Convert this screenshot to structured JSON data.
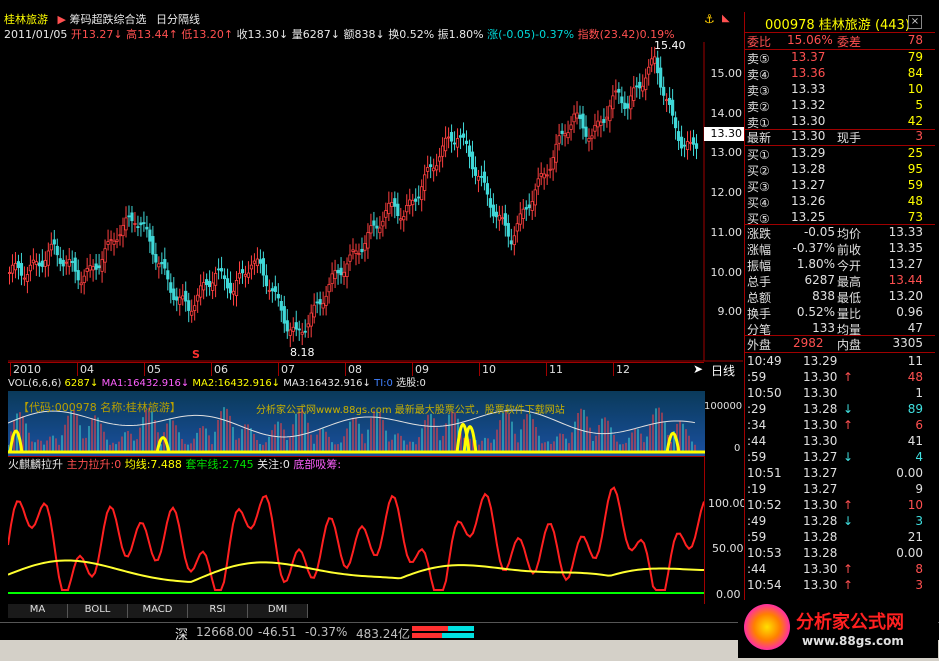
{
  "header": {
    "stock": "桂林旅游",
    "arrow": "▶",
    "formula": "筹码超跌综合选",
    "period": "日分隔线"
  },
  "info": {
    "date": "2011/01/05",
    "open": "开13.27↓",
    "high": "高13.44↑",
    "low": "低13.20↑",
    "close": "收13.30↓",
    "vol": "量6287↓",
    "amount": "额838↓",
    "turnover": "换0.52%",
    "amplitude": "振1.80%",
    "change": "涨(-0.05)-0.37%",
    "index": "指数(23.42)0.19%"
  },
  "price_axis": [
    "15.00",
    "14.00",
    "13.00",
    "12.00",
    "11.00",
    "10.00",
    "9.00"
  ],
  "price_marker": "13.30",
  "price_max_label": "15.40",
  "price_min_label": "8.18",
  "s_marker": "S",
  "months": [
    "2010",
    "04",
    "05",
    "06",
    "07",
    "08",
    "09",
    "10",
    "11",
    "12"
  ],
  "period_label": "日线",
  "vol_line": {
    "vol": "VOL(6,6,6)",
    "val": "6287↓",
    "ma1": "MA1:16432.916↓",
    "ma2": "MA2:16432.916↓",
    "ma3": "MA3:16432.916↓",
    "ti": "TI:0",
    "xg": "选股:0"
  },
  "vol_axis": [
    "100000",
    "0"
  ],
  "watermark1": "【代码:000978 名称:桂林旅游】",
  "watermark2": "分析家公式网www.88gs.com 最新最大股票公式，股票软件下载网站",
  "ind_line": {
    "name": "火麒麟拉升",
    "main": "主力拉升:0",
    "avg": "均线:7.488",
    "tao": "套牢线:2.745",
    "gz": "关注:0",
    "bottom": "底部吸筹:"
  },
  "ind_axis": [
    "100.00",
    "50.00",
    "0.00"
  ],
  "tabs": [
    "MA",
    "BOLL",
    "MACD",
    "RSI",
    "DMI"
  ],
  "status": {
    "mkt": "深",
    "idx": "12668.00",
    "chg": "-46.51",
    "pct": "-0.37%",
    "amt": "483.24亿"
  },
  "quote": {
    "code": "000978",
    "name": "桂林旅游",
    "count": "(443)",
    "weibi_l": "委比",
    "weibi": "15.06%",
    "weicha_l": "委差",
    "weicha": "78",
    "asks": [
      {
        "l": "卖⑤",
        "p": "13.37",
        "v": "79"
      },
      {
        "l": "卖④",
        "p": "13.36",
        "v": "84"
      },
      {
        "l": "卖③",
        "p": "13.33",
        "v": "10"
      },
      {
        "l": "卖②",
        "p": "13.32",
        "v": "5"
      },
      {
        "l": "卖①",
        "p": "13.30",
        "v": "42"
      }
    ],
    "last_l": "最新",
    "last": "13.30",
    "now_l": "现手",
    "now": "3",
    "bids": [
      {
        "l": "买①",
        "p": "13.29",
        "v": "25"
      },
      {
        "l": "买②",
        "p": "13.28",
        "v": "95"
      },
      {
        "l": "买③",
        "p": "13.27",
        "v": "59"
      },
      {
        "l": "买④",
        "p": "13.26",
        "v": "48"
      },
      {
        "l": "买⑤",
        "p": "13.25",
        "v": "73"
      }
    ],
    "stats": [
      [
        "涨跌",
        "-0.05",
        "均价",
        "13.33"
      ],
      [
        "涨幅",
        "-0.37%",
        "前收",
        "13.35"
      ],
      [
        "振幅",
        "1.80%",
        "今开",
        "13.27"
      ],
      [
        "总手",
        "6287",
        "最高",
        "13.44"
      ],
      [
        "总额",
        "838",
        "最低",
        "13.20"
      ],
      [
        "换手",
        "0.52%",
        "量比",
        "0.96"
      ],
      [
        "分笔",
        "133",
        "均量",
        "47"
      ]
    ],
    "wai_l": "外盘",
    "wai": "2982",
    "nei_l": "内盘",
    "nei": "3305"
  },
  "ticks": [
    [
      "10:49",
      "13.29",
      "",
      "11"
    ],
    [
      ":59",
      "13.30",
      "↑",
      "48"
    ],
    [
      "10:50",
      "13.30",
      "",
      "1"
    ],
    [
      ":29",
      "13.28",
      "↓",
      "89"
    ],
    [
      ":34",
      "13.30",
      "↑",
      "6"
    ],
    [
      ":44",
      "13.30",
      "",
      "41"
    ],
    [
      ":59",
      "13.27",
      "↓",
      "4"
    ],
    [
      "10:51",
      "13.27",
      "",
      "0.00"
    ],
    [
      ":19",
      "13.27",
      "",
      "9"
    ],
    [
      "10:52",
      "13.30",
      "↑",
      "10"
    ],
    [
      ":49",
      "13.28",
      "↓",
      "3"
    ],
    [
      ":59",
      "13.28",
      "",
      "21"
    ],
    [
      "10:53",
      "13.28",
      "",
      "0.00"
    ],
    [
      ":44",
      "13.30",
      "↑",
      "8"
    ],
    [
      "10:54",
      "13.30",
      "↑",
      "3"
    ]
  ],
  "logo": "分析家公式网",
  "logo_url": "www.88gs.com",
  "chart_data": {
    "type": "candlestick",
    "ylim": [
      7.8,
      15.8
    ],
    "months": [
      "2010",
      "04",
      "05",
      "06",
      "07",
      "08",
      "09",
      "10",
      "11",
      "12"
    ],
    "closes": [
      10.0,
      10.1,
      10.0,
      10.2,
      10.4,
      10.6,
      10.3,
      10.1,
      9.9,
      10.0,
      10.3,
      10.6,
      11.0,
      11.2,
      11.4,
      11.1,
      10.6,
      10.1,
      9.6,
      9.3,
      9.1,
      9.4,
      9.7,
      10.0,
      9.8,
      9.6,
      9.9,
      10.3,
      10.1,
      9.7,
      9.2,
      8.7,
      8.4,
      8.7,
      9.0,
      9.4,
      9.8,
      10.1,
      10.3,
      10.6,
      10.9,
      11.2,
      11.5,
      11.7,
      11.4,
      11.8,
      12.2,
      12.6,
      13.0,
      13.3,
      13.5,
      13.1,
      12.6,
      12.1,
      11.6,
      11.2,
      10.9,
      11.3,
      11.8,
      12.2,
      12.6,
      13.1,
      13.6,
      13.9,
      13.7,
      13.4,
      13.8,
      14.2,
      14.5,
      14.2,
      14.6,
      15.0,
      15.3,
      14.6,
      13.8,
      13.3,
      13.1,
      13.3
    ]
  }
}
